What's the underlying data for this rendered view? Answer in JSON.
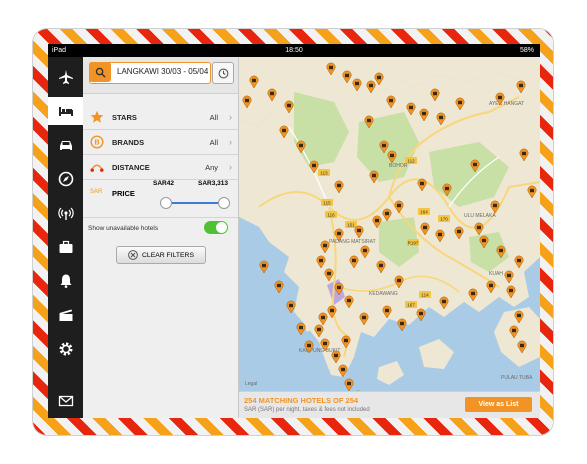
{
  "status_bar": {
    "device": "iPad",
    "time": "18:50",
    "battery": "58%"
  },
  "search": {
    "text": "LANGKAWI 30/03 - 05/04"
  },
  "filters": {
    "stars": {
      "label": "STARS",
      "value": "All"
    },
    "brands": {
      "label": "BRANDS",
      "value": "All"
    },
    "distance": {
      "label": "DISTANCE",
      "value": "Any"
    },
    "price": {
      "label": "PRICE",
      "currency": "SAR",
      "min": "SAR42",
      "max": "SAR3,313"
    },
    "unavailable_label": "Show unavailable hotels",
    "clear_label": "CLEAR FILTERS"
  },
  "map": {
    "labels": [
      "KUAH",
      "PADANG MATSIRAT",
      "KEDAWANG",
      "ULU MELAKA",
      "BOHOR",
      "AYER HANGAT",
      "PULAU TUBA",
      "KAMPUNG BUKIT",
      "Legal"
    ],
    "road_numbers": [
      "113",
      "112",
      "115",
      "116",
      "151",
      "R197",
      "164",
      "170",
      "167",
      "114"
    ]
  },
  "footer": {
    "title": "254 MATCHING HOTELS OF 254",
    "subtitle": "SAR (SAR) per night, taxes & fees not included",
    "view_list_label": "View as List"
  },
  "colors": {
    "accent": "#f29425",
    "toggle": "#4ec232",
    "slider": "#3c7bd7"
  }
}
